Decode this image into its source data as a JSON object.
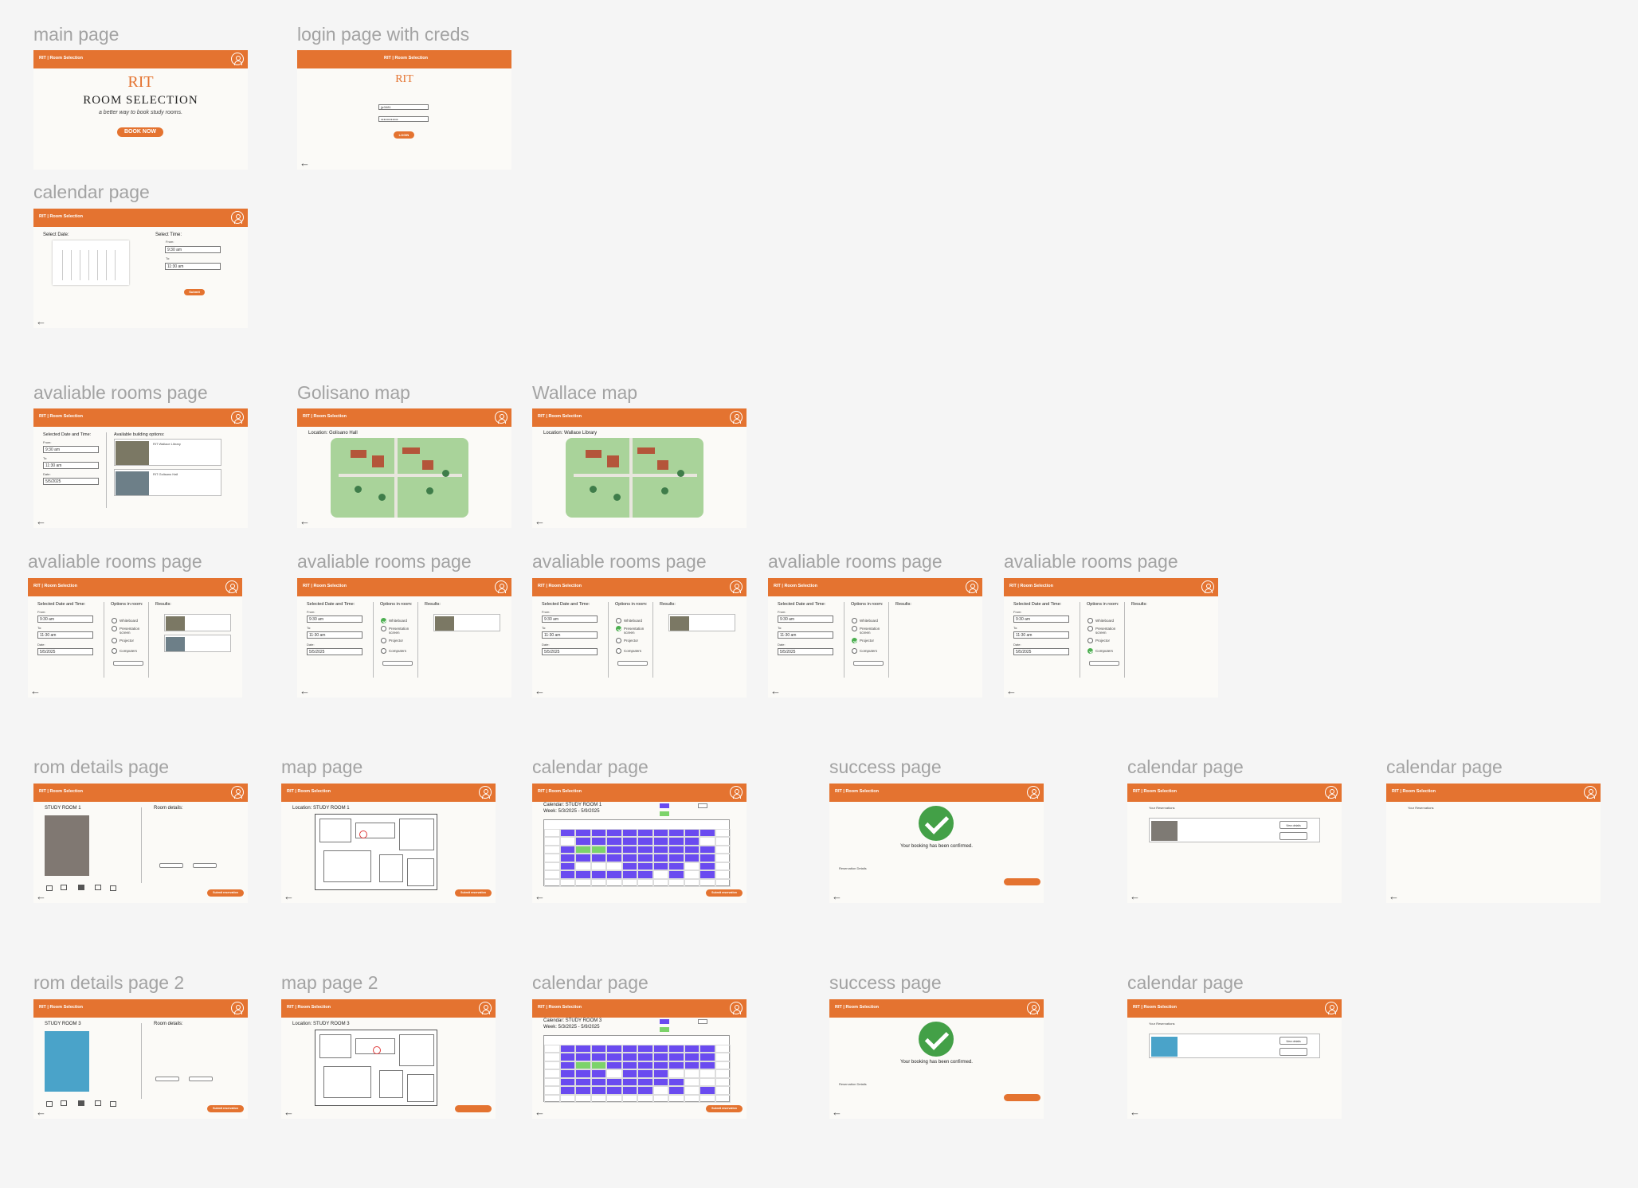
{
  "app": {
    "brand": "RIT | Room Selection",
    "back_glyph": "←"
  },
  "frames": {
    "main": {
      "title": "main page",
      "logo": "RIT",
      "heading": "ROOM SELECTION",
      "tagline": "a better way to book study rooms.",
      "cta": "BOOK NOW"
    },
    "login": {
      "title": "login page with creds",
      "logo": "RIT",
      "username": "jjz3481",
      "password": "●●●●●●●●●●●●",
      "button": "LOGIN"
    },
    "calendar_select": {
      "title": "calendar page",
      "select_date": "Select Date:",
      "select_time": "Select Time:",
      "from_label": "From:",
      "from_value": "9:30 am",
      "to_label": "To:",
      "to_value": "11:30 am",
      "submit": "Submit"
    },
    "available_buildings": {
      "title": "avaliable rooms page",
      "selected": "Selected Date and Time:",
      "options": "Available building options:",
      "from_label": "From:",
      "from_value": "9:30 am",
      "to_label": "To:",
      "to_value": "11:30 am",
      "date_label": "Date:",
      "date_value": "5/5/2025",
      "building1": "RIT Wallace Library",
      "building2": "RIT Golisano Hall"
    },
    "golisano_map": {
      "title": "Golisano map",
      "location": "Location: Golisano Hall"
    },
    "wallace_map": {
      "title": "Wallace map",
      "location": "Location: Wallace Library"
    },
    "rooms_filters": {
      "title": "avaliable rooms page",
      "selected": "Selected Date and Time:",
      "options_label": "Options in room:",
      "results_label": "Results:",
      "options": [
        "Whiteboard",
        "Presentation screen",
        "Projector",
        "Computers"
      ],
      "from_value": "9:30 am",
      "to_value": "11:30 am",
      "date_value": "5/5/2025",
      "from_label": "From:",
      "to_label": "To:",
      "date_label": "Date:"
    },
    "room_details_1": {
      "title": "rom details page",
      "room": "STUDY ROOM 1",
      "details": "Room details:",
      "submit": "Submit reservation"
    },
    "map_page_1": {
      "title": "map page",
      "location": "Location: STUDY ROOM 1",
      "submit": "Submit reservation"
    },
    "calendar_room_1": {
      "title": "calendar page",
      "calendar": "Calendar: STUDY ROOM 1",
      "week": "Week: 5/3/2025 - 5/9/2025",
      "submit": "Submit reservation"
    },
    "success_1": {
      "title": "success page",
      "message": "Your booking has been confirmed.",
      "reservation": "Reservation Details"
    },
    "reservations_1": {
      "title": "calendar page",
      "label": "Your Reservations",
      "view": "View details"
    },
    "reservations_empty": {
      "title": "calendar page",
      "label": "Your Reservations"
    },
    "room_details_2": {
      "title": "rom details page 2",
      "room": "STUDY ROOM 3",
      "details": "Room details:",
      "submit": "Submit reservation"
    },
    "map_page_2": {
      "title": "map page 2",
      "location": "Location: STUDY ROOM 3"
    },
    "calendar_room_3": {
      "title": "calendar page",
      "calendar": "Calendar: STUDY ROOM 3",
      "week": "Week: 5/3/2025 - 5/9/2025",
      "submit": "Submit reservation"
    },
    "success_2": {
      "title": "success page",
      "message": "Your booking has been confirmed.",
      "reservation": "Reservation Details"
    },
    "reservations_2": {
      "title": "calendar page",
      "label": "Your Reservations",
      "view": "View details"
    }
  },
  "colors": {
    "brand": "#e47330",
    "reserved": "#6a4bf0",
    "your_time": "#7cd36a",
    "confirm": "#43a047"
  }
}
